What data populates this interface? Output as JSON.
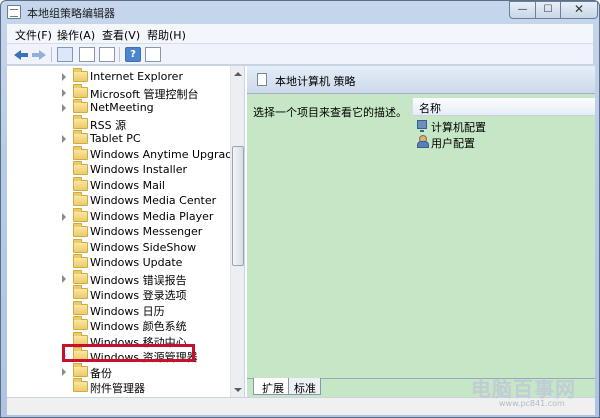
{
  "window": {
    "title": "本地组策略编辑器",
    "buttons": {
      "minimize": "—",
      "maximize": "☐",
      "close": "✕"
    }
  },
  "menu": [
    "文件(F)",
    "操作(A)",
    "查看(V)",
    "帮助(H)"
  ],
  "toolbar": {
    "icons": [
      "back-arrow-icon",
      "forward-arrow-icon",
      "console-tree-icon",
      "show-hide-icon",
      "export-list-icon",
      "help-icon",
      "properties-icon"
    ],
    "help_glyph": "?"
  },
  "tree": {
    "items": [
      {
        "label": "Internet Explorer",
        "expandable": true
      },
      {
        "label": "Microsoft 管理控制台",
        "expandable": true
      },
      {
        "label": "NetMeeting",
        "expandable": true
      },
      {
        "label": "RSS 源",
        "expandable": false
      },
      {
        "label": "Tablet PC",
        "expandable": true
      },
      {
        "label": "Windows Anytime Upgrade",
        "expandable": false
      },
      {
        "label": "Windows Installer",
        "expandable": false
      },
      {
        "label": "Windows Mail",
        "expandable": false
      },
      {
        "label": "Windows Media Center",
        "expandable": false
      },
      {
        "label": "Windows Media Player",
        "expandable": true
      },
      {
        "label": "Windows Messenger",
        "expandable": false
      },
      {
        "label": "Windows SideShow",
        "expandable": false
      },
      {
        "label": "Windows Update",
        "expandable": false
      },
      {
        "label": "Windows 错误报告",
        "expandable": true
      },
      {
        "label": "Windows 登录选项",
        "expandable": false
      },
      {
        "label": "Windows 日历",
        "expandable": false
      },
      {
        "label": "Windows 颜色系统",
        "expandable": false
      },
      {
        "label": "Windows 移动中心",
        "expandable": false
      },
      {
        "label": "Windows 资源管理器",
        "expandable": true,
        "highlighted": true
      },
      {
        "label": "备份",
        "expandable": true
      },
      {
        "label": "附件管理器",
        "expandable": false
      }
    ]
  },
  "right_pane": {
    "title": "本地计算机 策略",
    "description": "选择一个项目来查看它的描述。",
    "column_header": "名称",
    "items": [
      {
        "label": "计算机配置",
        "icon": "computer-icon"
      },
      {
        "label": "用户配置",
        "icon": "user-icon"
      }
    ],
    "tabs": [
      "扩展",
      "标准"
    ],
    "active_tab": "扩展"
  },
  "watermark": {
    "text": "电脑百事网",
    "sub": "www.pc841.com"
  },
  "colors": {
    "highlight_border": "#c8102e",
    "right_pane_bg": "#c6e7c5",
    "folder": "#eccb6a"
  }
}
